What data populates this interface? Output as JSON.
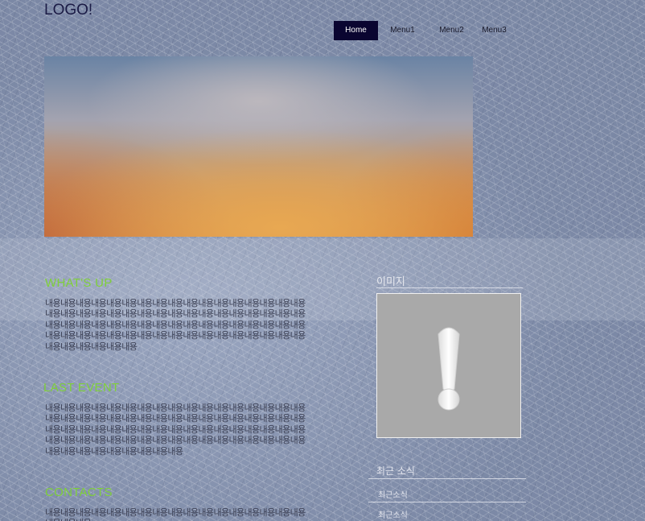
{
  "header": {
    "logo": "LOGO!",
    "nav": [
      {
        "label": "Home",
        "active": true
      },
      {
        "label": "Menu1",
        "active": false
      },
      {
        "label": "Menu2",
        "active": false
      },
      {
        "label": "Menu3",
        "active": false
      }
    ]
  },
  "main": {
    "sections": [
      {
        "title": "WHAT'S UP",
        "text": "내용내용내용내용내용내용내용내용내용내용내용내용내용내용내용내용내용내용내용내용내용내용내용내용내용내용내용내용내용내용내용내용내용내용내용내용내용내용내용내용내용내용내용내용내용내용내용내용내용내용내용내용내용내용내용내용내용내용내용내용내용내용내용내용내용내용내용내용내용내용내용내용내용내용"
      },
      {
        "title": "LAST EVENT",
        "text": "내용내용내용내용내용내용내용내용내용내용내용내용내용내용내용내용내용내용내용내용내용내용내용내용내용내용내용내용내용내용내용내용내용내용내용내용내용내용내용내용내용내용내용내용내용내용내용내용내용내용내용내용내용내용내용내용내용내용내용내용내용내용내용내용내용내용내용내용내용내용내용내용내용내용내용내용내용"
      },
      {
        "title": "CONTACTS",
        "text": "내용내용내용내용내용내용내용내용내용내용내용내용내용내용내용내용내용내용내용내용"
      }
    ]
  },
  "sidebar": {
    "image_title": "이미지",
    "image_icon": "broken-image-exclamation-icon",
    "news_title": "최근 소식",
    "news_items": [
      "최근소식",
      "최근소식"
    ]
  },
  "colors": {
    "accent": "#7fd03a",
    "nav_active_bg": "#0a0530",
    "logo": "#1b1b45"
  }
}
